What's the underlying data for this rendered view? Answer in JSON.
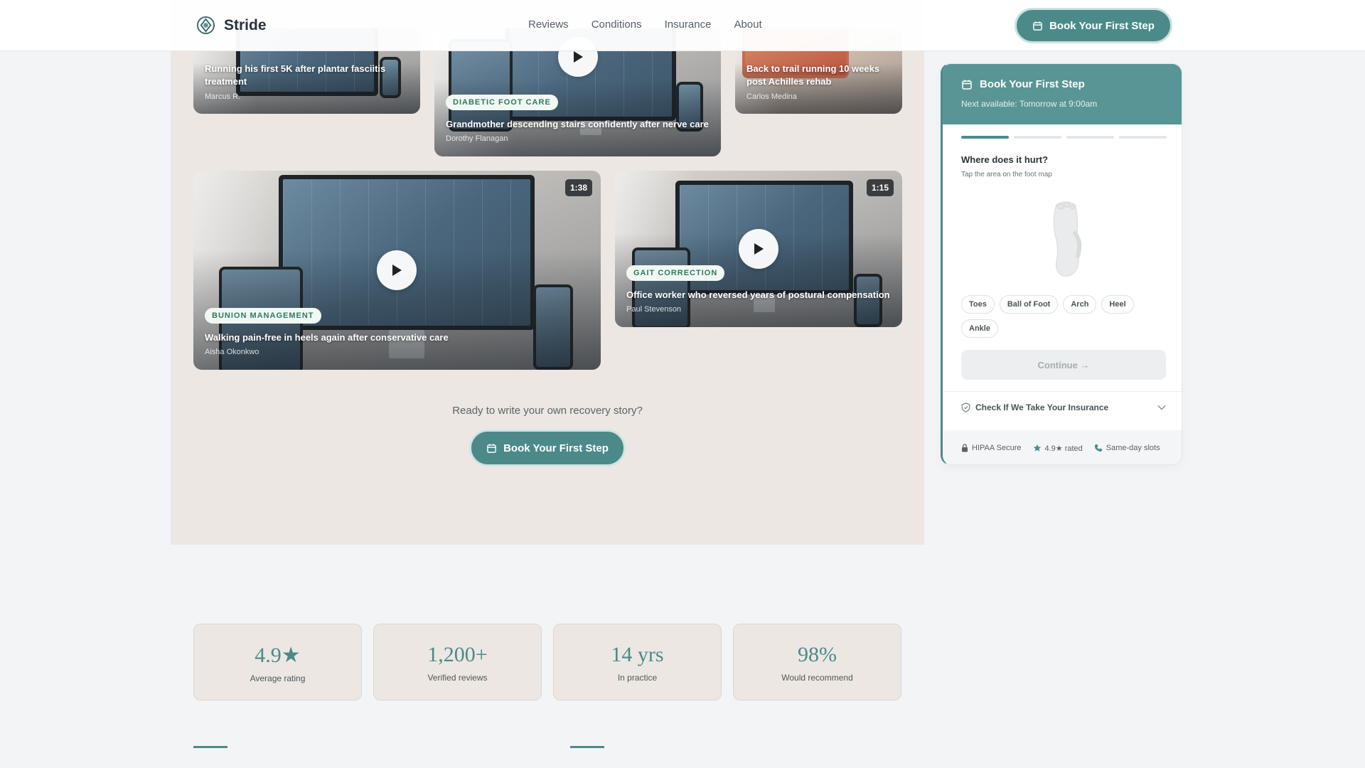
{
  "header": {
    "brand": "Stride",
    "nav": [
      "Reviews",
      "Conditions",
      "Insurance",
      "About"
    ],
    "cta_label": "Book Your First Step"
  },
  "videos": [
    {
      "title": "Running his first 5K after plantar fasciitis treatment",
      "author": "Marcus R."
    },
    {
      "tag": "DIABETIC FOOT CARE",
      "title": "Grandmother descending stairs confidently after nerve care",
      "author": "Dorothy Flanagan"
    },
    {
      "title": "Back to trail running 10 weeks post Achilles rehab",
      "author": "Carlos Medina"
    },
    {
      "tag": "BUNION MANAGEMENT",
      "title": "Walking pain-free in heels again after conservative care",
      "author": "Aisha Okonkwo",
      "duration": "1:38"
    },
    {
      "tag": "GAIT CORRECTION",
      "title": "Office worker who reversed years of postural compensation",
      "author": "Paul Stevenson",
      "duration": "1:15"
    }
  ],
  "story": {
    "prompt": "Ready to write your own recovery story?",
    "cta_label": "Book Your First Step"
  },
  "stats": [
    {
      "value": "4.9★",
      "label": "Average rating"
    },
    {
      "value": "1,200+",
      "label": "Verified reviews"
    },
    {
      "value": "14 yrs",
      "label": "In practice"
    },
    {
      "value": "98%",
      "label": "Would recommend"
    }
  ],
  "widget": {
    "title": "Book Your First Step",
    "subtitle": "Next available: Tomorrow at 9:00am",
    "progress": {
      "step": 1,
      "total": 4
    },
    "question": "Where does it hurt?",
    "hint": "Tap the area on the foot map",
    "chips": [
      "Toes",
      "Ball of Foot",
      "Arch",
      "Heel",
      "Ankle"
    ],
    "continue_label": "Continue →",
    "insurance_label": "Check If We Take Your Insurance",
    "trust": [
      "HIPAA Secure",
      "4.9★ rated",
      "Same-day slots"
    ]
  },
  "colors": {
    "accent": "#4c8a8a",
    "widget_header": "#5a9595",
    "panel": "#ece7e3",
    "page": "#f3f4f6",
    "tag_text": "#2f7a5e"
  },
  "icons": [
    "stride-logo-icon",
    "calendar-icon",
    "play-icon",
    "shield-icon",
    "chevron-down-icon",
    "lock-icon",
    "star-icon",
    "phone-icon"
  ]
}
